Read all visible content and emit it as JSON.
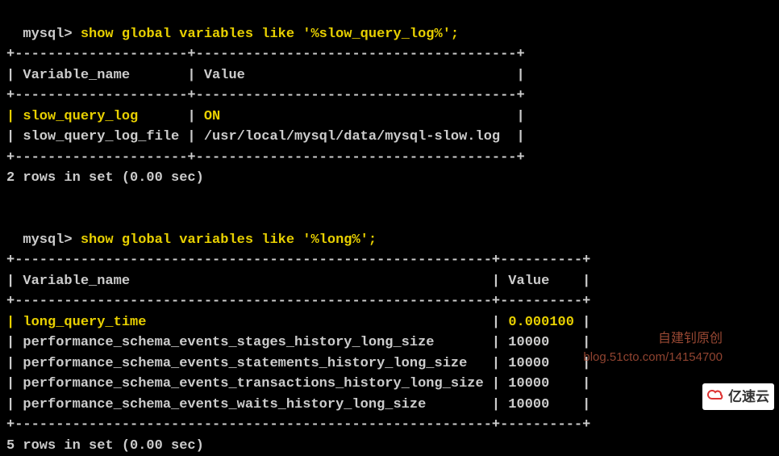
{
  "prompt": "mysql> ",
  "query1": {
    "command": "show global variables like '%slow_query_log%';",
    "border_top": "+---------------------+---------------------------------------+",
    "header": "| Variable_name       | Value                                 |",
    "border_mid": "+---------------------+---------------------------------------+",
    "rows": [
      {
        "name_hl": "| slow_query_log      ",
        "pipe": "| ",
        "val_hl": "ON                                    ",
        "end": "|"
      },
      {
        "name": "| slow_query_log_file | /usr/local/mysql/data/mysql-slow.log  |"
      }
    ],
    "border_bot": "+---------------------+---------------------------------------+",
    "status": "2 rows in set (0.00 sec)"
  },
  "query2": {
    "command": "show global variables like '%long%';",
    "border_top": "+----------------------------------------------------------+----------+",
    "header": "| Variable_name                                            | Value    |",
    "border_mid": "+----------------------------------------------------------+----------+",
    "rows": [
      {
        "name_hl": "| long_query_time                                          ",
        "pipe": "| ",
        "val_hl": "0.000100 ",
        "end": "|"
      },
      {
        "name": "| performance_schema_events_stages_history_long_size       | 10000    |"
      },
      {
        "name": "| performance_schema_events_statements_history_long_size   | 10000    |"
      },
      {
        "name": "| performance_schema_events_transactions_history_long_size | 10000    |"
      },
      {
        "name": "| performance_schema_events_waits_history_long_size        | 10000    |"
      }
    ],
    "border_bot": "+----------------------------------------------------------+----------+",
    "status": "5 rows in set (0.00 sec)"
  },
  "watermark1": "自建钊原创",
  "watermark2": "blog.51cto.com/14154700",
  "logo_text": "亿速云",
  "chart_data": {
    "type": "table",
    "tables": [
      {
        "query": "show global variables like '%slow_query_log%';",
        "columns": [
          "Variable_name",
          "Value"
        ],
        "rows": [
          [
            "slow_query_log",
            "ON"
          ],
          [
            "slow_query_log_file",
            "/usr/local/mysql/data/mysql-slow.log"
          ]
        ],
        "row_count": 2,
        "time_sec": 0.0
      },
      {
        "query": "show global variables like '%long%';",
        "columns": [
          "Variable_name",
          "Value"
        ],
        "rows": [
          [
            "long_query_time",
            "0.000100"
          ],
          [
            "performance_schema_events_stages_history_long_size",
            "10000"
          ],
          [
            "performance_schema_events_statements_history_long_size",
            "10000"
          ],
          [
            "performance_schema_events_transactions_history_long_size",
            "10000"
          ],
          [
            "performance_schema_events_waits_history_long_size",
            "10000"
          ]
        ],
        "row_count": 5,
        "time_sec": 0.0
      }
    ]
  }
}
